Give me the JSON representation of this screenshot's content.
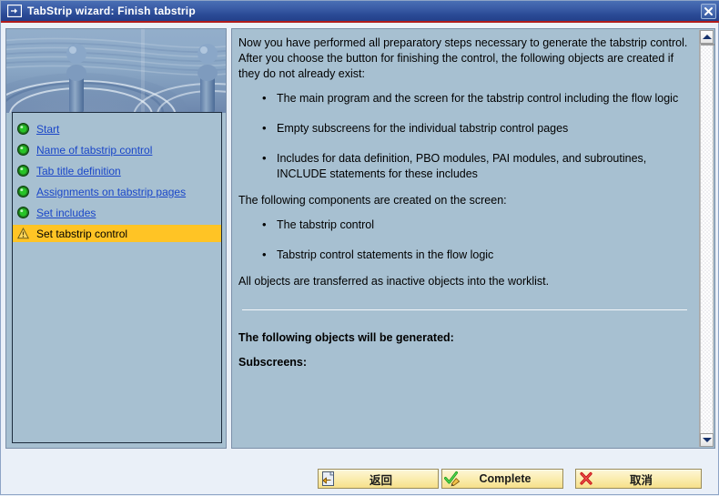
{
  "window": {
    "title": "TabStrip wizard: Finish tabstrip",
    "title_icon": "wizard-window-icon",
    "close_icon": "close-icon",
    "accent_title_color": "#2a4a95",
    "panel_bg_color": "#a7c0d1",
    "highlight_color": "#ffc425",
    "link_color": "#1a46c8"
  },
  "sidebar": {
    "banner_icon": "water-ripple-banner-image",
    "items": [
      {
        "label": "Start",
        "icon": "green-status-circle-icon",
        "state": "done"
      },
      {
        "label": "Name of tabstrip control",
        "icon": "green-status-circle-icon",
        "state": "done"
      },
      {
        "label": "Tab title definition",
        "icon": "green-status-circle-icon",
        "state": "done"
      },
      {
        "label": "Assignments on tabstrip pages",
        "icon": "green-status-circle-icon",
        "state": "done"
      },
      {
        "label": "Set includes",
        "icon": "green-status-circle-icon",
        "state": "done"
      },
      {
        "label": "Set tabstrip control",
        "icon": "yellow-warning-triangle-icon",
        "state": "current"
      }
    ]
  },
  "content": {
    "intro": "Now you have performed all preparatory steps necessary to generate the tabstrip control. After you choose the button for finishing the control, the following objects are created if they do not already exist:",
    "bullets_created": [
      "The main program and the screen for the tabstrip control including the flow logic",
      "Empty subscreens for the individual tabstrip control pages",
      "Includes for data definition, PBO modules, PAI modules, and subroutines, INCLUDE statements for these includes"
    ],
    "components_heading": "The following components are created on the screen:",
    "bullets_components": [
      "The tabstrip control",
      "Tabstrip control statements in the flow logic"
    ],
    "worklist_note": "All objects are transferred as inactive objects into the worklist.",
    "generated_heading": "The following objects will be generated:",
    "subscreens_heading": "Subscreens:"
  },
  "scrollbar": {
    "up_icon": "scroll-up-arrow-icon",
    "down_icon": "scroll-down-arrow-icon"
  },
  "footer": {
    "buttons": [
      {
        "id": "back",
        "label": "返回",
        "icon": "back-document-arrow-icon"
      },
      {
        "id": "complete",
        "label": "Complete",
        "icon": "green-check-pencil-icon"
      },
      {
        "id": "cancel",
        "label": "取消",
        "icon": "red-x-icon"
      }
    ]
  }
}
